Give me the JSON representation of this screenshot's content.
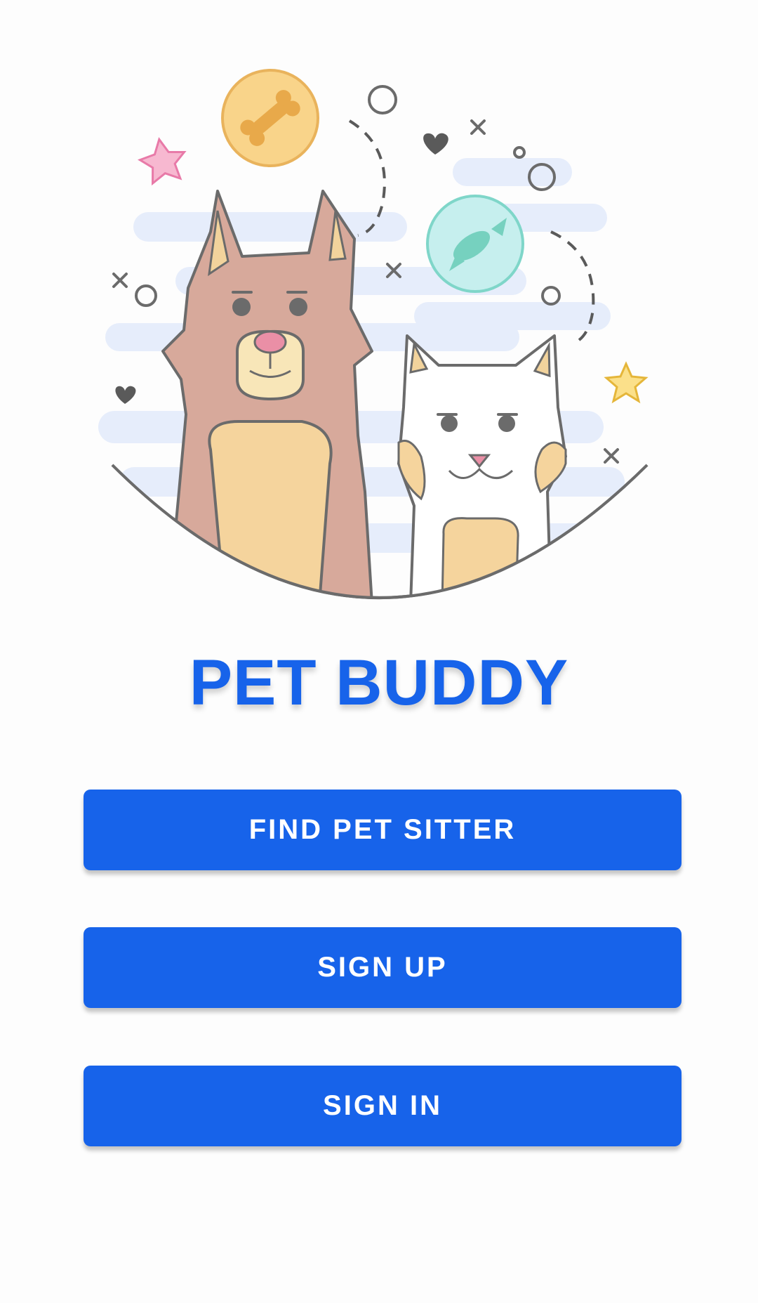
{
  "app": {
    "title": "PET BUDDY"
  },
  "hero": {
    "illustration": "dog-and-cat-illustration"
  },
  "actions": {
    "find_pet_sitter_label": "FIND PET SITTER",
    "sign_up_label": "SIGN UP",
    "sign_in_label": "SIGN IN"
  },
  "colors": {
    "primary": "#1763ea",
    "background": "#fdfdfd",
    "button_text": "#ffffff"
  }
}
